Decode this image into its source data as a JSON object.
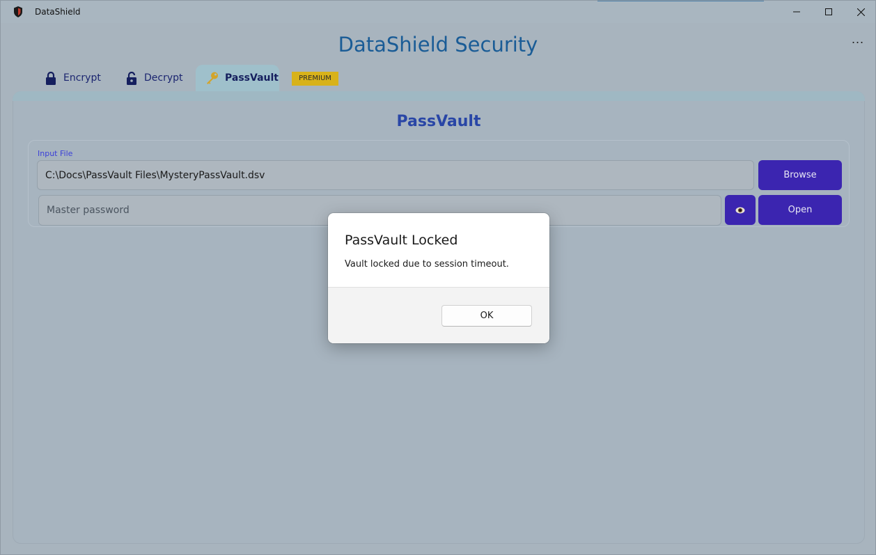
{
  "window": {
    "title": "DataShield",
    "controls": {
      "minimize_icon": "minimize-icon",
      "maximize_icon": "maximize-icon",
      "close_icon": "close-icon"
    }
  },
  "header": {
    "app_title": "DataShield Security",
    "more_label": "..."
  },
  "tabs": [
    {
      "label": "Encrypt",
      "icon": "lock-icon",
      "selected": false
    },
    {
      "label": "Decrypt",
      "icon": "unlock-icon",
      "selected": false
    },
    {
      "label": "PassVault",
      "icon": "key-icon",
      "selected": true
    }
  ],
  "premium_badge": "PREMIUM",
  "passvault": {
    "section_title": "PassVault",
    "input_label": "Input File",
    "file_path": "C:\\Docs\\PassVault Files\\MysteryPassVault.dsv",
    "browse_label": "Browse",
    "password_placeholder": "Master password",
    "eye_icon": "eye-icon",
    "open_label": "Open"
  },
  "dialog": {
    "title": "PassVault Locked",
    "message": "Vault locked due to session timeout.",
    "ok_label": "OK"
  },
  "colors": {
    "accent": "#3b25b0",
    "title_blue": "#1a5c96",
    "section_blue": "#2946a6",
    "premium": "#d8b21a"
  }
}
